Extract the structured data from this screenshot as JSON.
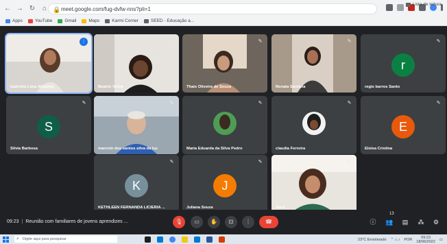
{
  "browser": {
    "url": "meet.google.com/fug-dvfw-nns?pli=1",
    "bookmarks": [
      {
        "label": "Apps",
        "color": "#4285f4",
        "icon": "apps-icon"
      },
      {
        "label": "YouTube",
        "color": "#ea4335",
        "icon": "youtube-icon"
      },
      {
        "label": "Gmail",
        "color": "#34a853",
        "icon": "gmail-icon"
      },
      {
        "label": "Maps",
        "color": "#fbbc04",
        "icon": "maps-icon"
      },
      {
        "label": "Karmi Corner",
        "color": "#5f6368",
        "icon": "globe-icon"
      },
      {
        "label": "SEED - Educação a...",
        "color": "#5f6368",
        "icon": "globe-icon"
      }
    ],
    "reading_list": "Lista de leitura"
  },
  "meet": {
    "participants": [
      {
        "name": "Gabriela Lima Ximenes",
        "kind": "video",
        "speaking": true
      },
      {
        "name": "Beatriz Vieira",
        "kind": "video"
      },
      {
        "name": "Thais Oliveira de Souza",
        "kind": "video"
      },
      {
        "name": "Renata Santana",
        "kind": "video"
      },
      {
        "name": "regis barros Santo",
        "kind": "avatar",
        "initial": "r",
        "color": "#0b8043"
      },
      {
        "name": "Silvia Barbosa",
        "kind": "avatar",
        "initial": "S",
        "color": "#0f5e4a"
      },
      {
        "name": "marcelo dos santos silva da luz",
        "kind": "video"
      },
      {
        "name": "Maria Eduarda da Silva Pedro",
        "kind": "video"
      },
      {
        "name": "claudia Ferreira",
        "kind": "video"
      },
      {
        "name": "Eloisa Cristina",
        "kind": "avatar",
        "initial": "E",
        "color": "#e8590c"
      },
      {
        "name": "KETHLEEN FERNANDA LICIERIA ...",
        "kind": "avatar",
        "initial": "K",
        "color": "#78909c"
      },
      {
        "name": "Juliana Souza",
        "kind": "avatar",
        "initial": "J",
        "color": "#f57c00"
      },
      {
        "name": "Você",
        "kind": "video"
      }
    ],
    "time": "09:23",
    "meeting_title": "Reunião com familiares de jovens aprendizes ...",
    "participant_count": "13"
  },
  "taskbar": {
    "search_placeholder": "Digite aqui para pesquisar",
    "weather": "23°C Ensolarado",
    "clock_time": "09:23",
    "clock_date": "18/06/2022",
    "lang": "POR"
  }
}
